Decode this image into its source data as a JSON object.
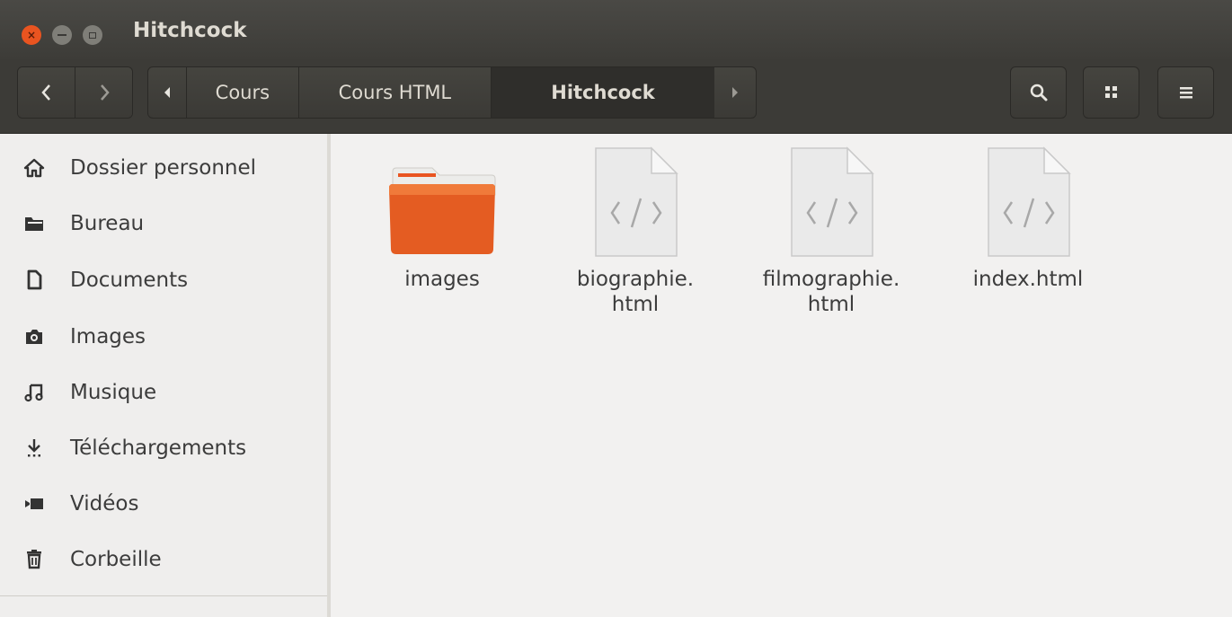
{
  "window": {
    "title": "Hitchcock"
  },
  "toolbar": {
    "breadcrumbs": [
      "Cours",
      "Cours HTML",
      "Hitchcock"
    ],
    "icons": {
      "back": "chevron-left-icon",
      "forward": "chevron-right-icon",
      "search": "search-icon",
      "view": "grid-view-icon",
      "menu": "hamburger-menu-icon"
    }
  },
  "sidebar": {
    "items": [
      {
        "label": "Dossier personnel",
        "icon": "home-icon"
      },
      {
        "label": "Bureau",
        "icon": "folder-icon"
      },
      {
        "label": "Documents",
        "icon": "document-icon"
      },
      {
        "label": "Images",
        "icon": "camera-icon"
      },
      {
        "label": "Musique",
        "icon": "music-note-icon"
      },
      {
        "label": "Téléchargements",
        "icon": "download-icon"
      },
      {
        "label": "Vidéos",
        "icon": "video-camera-icon"
      },
      {
        "label": "Corbeille",
        "icon": "trash-icon"
      }
    ]
  },
  "files": [
    {
      "name": "images",
      "type": "folder"
    },
    {
      "name": "biographie.\nhtml",
      "type": "html"
    },
    {
      "name": "filmographie.\nhtml",
      "type": "html"
    },
    {
      "name": "index.html",
      "type": "html"
    }
  ],
  "colors": {
    "accent": "#e95420",
    "titlebar": "#3c3b37",
    "sidebar_bg": "#efeeed",
    "content_bg": "#f2f1f0"
  }
}
